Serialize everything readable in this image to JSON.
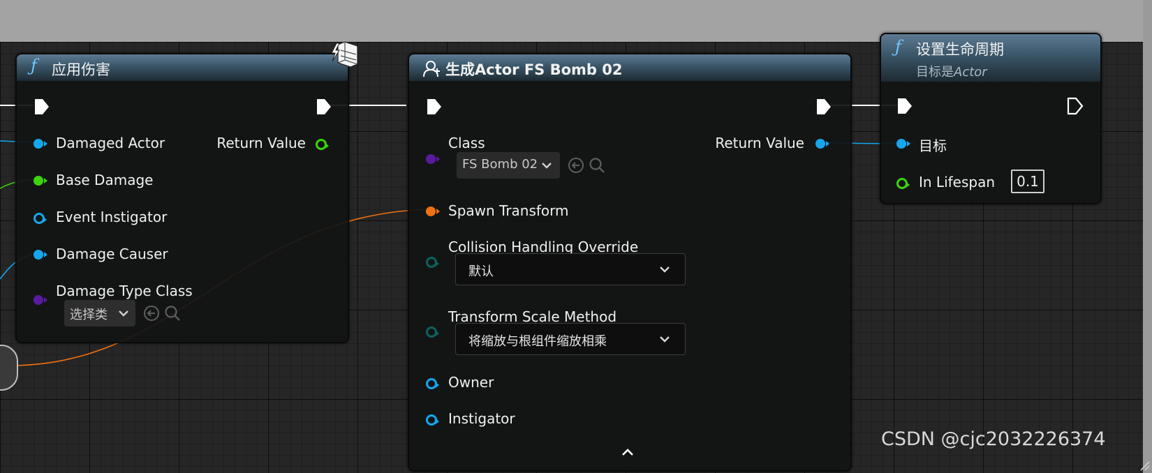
{
  "colors": {
    "exec": "#ffffff",
    "object": "#16a6ee",
    "float": "#3bd40e",
    "class": "#5a1aa0",
    "struct_transform": "#f07012",
    "enum": "#0b6260"
  },
  "node_apply_damage": {
    "title": "应用伤害",
    "icon": "function-icon",
    "inputs": [
      {
        "label": "Damaged Actor",
        "pin": "object"
      },
      {
        "label": "Base Damage",
        "pin": "float"
      },
      {
        "label": "Event Instigator",
        "pin": "object"
      },
      {
        "label": "Damage Causer",
        "pin": "object"
      },
      {
        "label": "Damage Type Class",
        "pin": "class"
      }
    ],
    "return_label": "Return Value",
    "class_select": "选择类"
  },
  "node_spawn": {
    "title": "生成Actor FS Bomb 02",
    "icon": "spawn-actor-icon",
    "class_label": "Class",
    "class_value": "FS Bomb 02",
    "return_label": "Return Value",
    "spawn_transform_label": "Spawn Transform",
    "collision_label": "Collision Handling Override",
    "collision_value": "默认",
    "scale_label": "Transform Scale Method",
    "scale_value": "将缩放与根组件缩放相乘",
    "owner_label": "Owner",
    "instigator_label": "Instigator"
  },
  "node_lifespan": {
    "title": "设置生命周期",
    "subtitle_prefix": "目标是",
    "subtitle_target": "Actor",
    "target_label": "目标",
    "lifespan_label": "In Lifespan",
    "lifespan_value": "0.1"
  },
  "watermark": "CSDN @cjc2032226374"
}
